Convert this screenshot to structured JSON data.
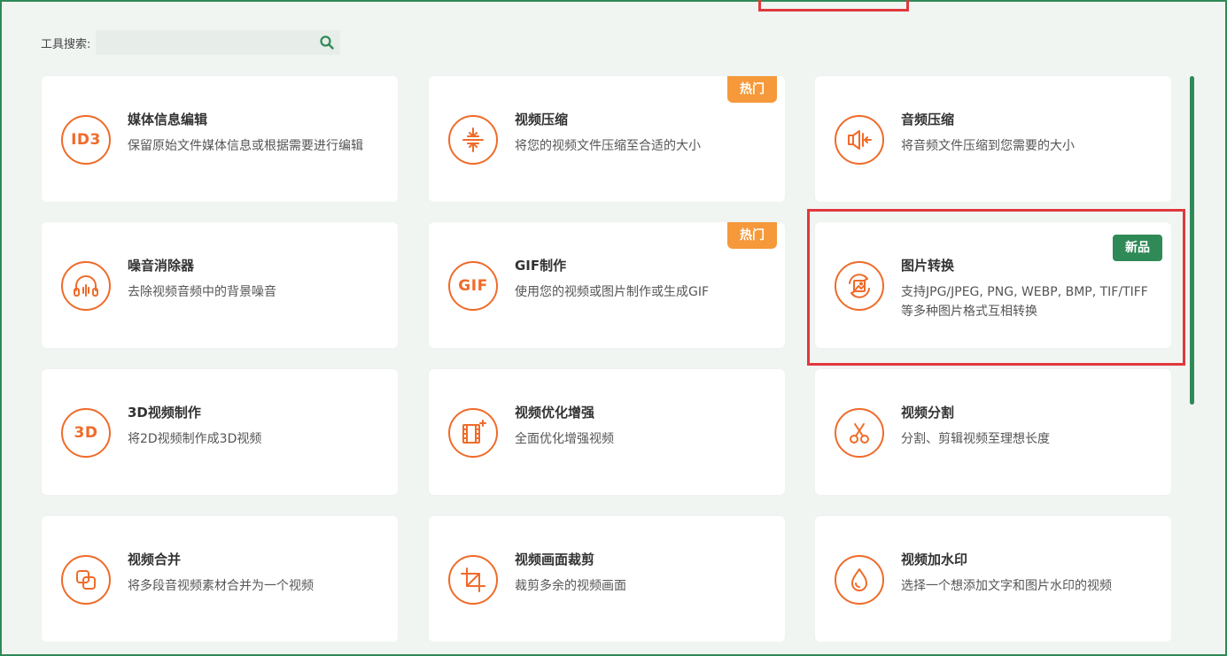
{
  "search": {
    "label": "工具搜索:",
    "placeholder": ""
  },
  "colors": {
    "accent": "#ef6b2a",
    "hot_badge": "#f5993b",
    "new_badge": "#2f8a57",
    "frame": "#2f8a57",
    "highlight": "#e0383c"
  },
  "tools": [
    {
      "title": "媒体信息编辑",
      "desc": "保留原始文件媒体信息或根据需要进行编辑",
      "icon": "id3-icon",
      "icon_text": "ID3",
      "badge": ""
    },
    {
      "title": "视频压缩",
      "desc": "将您的视频文件压缩至合适的大小",
      "icon": "compress-icon",
      "icon_text": "",
      "badge": "热门"
    },
    {
      "title": "音频压缩",
      "desc": "将音频文件压缩到您需要的大小",
      "icon": "audio-compress-icon",
      "icon_text": "",
      "badge": ""
    },
    {
      "title": "噪音消除器",
      "desc": "去除视频音频中的背景噪音",
      "icon": "noise-headphone-icon",
      "icon_text": "",
      "badge": ""
    },
    {
      "title": "GIF制作",
      "desc": "使用您的视频或图片制作或生成GIF",
      "icon": "gif-icon",
      "icon_text": "GIF",
      "badge": "热门"
    },
    {
      "title": "图片转换",
      "desc": "支持JPG/JPEG, PNG, WEBP, BMP, TIF/TIFF等多种图片格式互相转换",
      "icon": "image-convert-icon",
      "icon_text": "",
      "badge": "新品"
    },
    {
      "title": "3D视频制作",
      "desc": "将2D视频制作成3D视频",
      "icon": "3d-icon",
      "icon_text": "3D",
      "badge": ""
    },
    {
      "title": "视频优化增强",
      "desc": "全面优化增强视频",
      "icon": "film-enhance-icon",
      "icon_text": "",
      "badge": ""
    },
    {
      "title": "视频分割",
      "desc": "分割、剪辑视频至理想长度",
      "icon": "scissors-icon",
      "icon_text": "",
      "badge": ""
    },
    {
      "title": "视频合并",
      "desc": "将多段音视频素材合并为一个视频",
      "icon": "merge-icon",
      "icon_text": "",
      "badge": ""
    },
    {
      "title": "视频画面裁剪",
      "desc": "裁剪多余的视频画面",
      "icon": "crop-icon",
      "icon_text": "",
      "badge": ""
    },
    {
      "title": "视频加水印",
      "desc": "选择一个想添加文字和图片水印的视频",
      "icon": "water-drop-icon",
      "icon_text": "",
      "badge": ""
    }
  ]
}
